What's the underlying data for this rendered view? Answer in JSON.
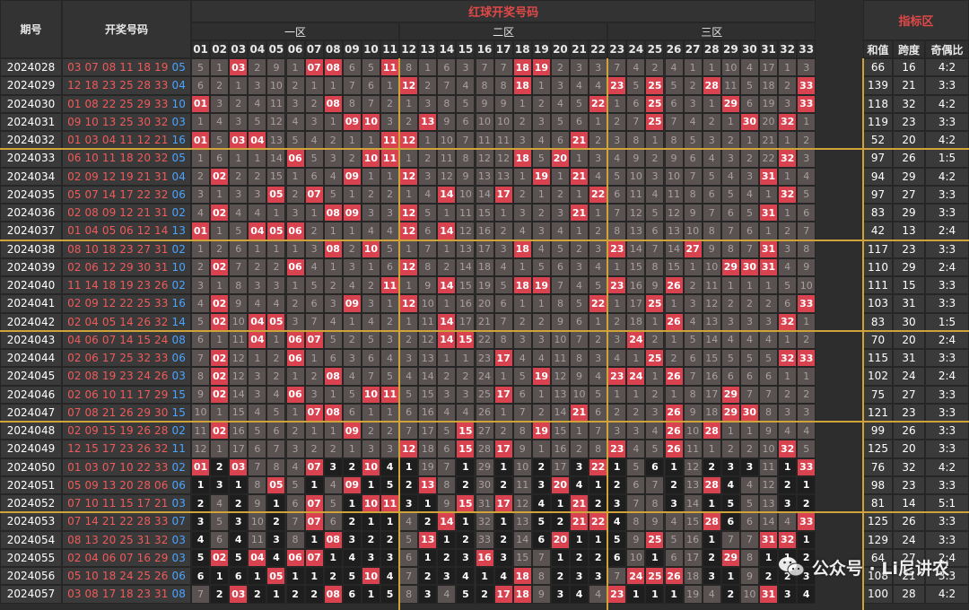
{
  "header": {
    "period_label": "期号",
    "numbers_label": "开奖号码",
    "red_title": "红球开奖号码",
    "index_title": "指标区",
    "zones": [
      "一区",
      "二区",
      "三区"
    ],
    "index_cols": [
      "和值",
      "跨度",
      "奇偶比"
    ]
  },
  "colors": {
    "hit": "#d9424f",
    "miss": "#5a5151",
    "dark": "#1e1e1e",
    "divider": "#cfa23a",
    "red_text": "#f05a5a",
    "blue_text": "#4aa3ff"
  },
  "rows": [
    {
      "p": "2024028",
      "red": "03 07 08 11 18 19",
      "blue": "05",
      "sum": "66",
      "span": "16",
      "ratio": "4:2",
      "miss": [
        5,
        1,
        0,
        2,
        9,
        1,
        0,
        0,
        6,
        5,
        0,
        8,
        1,
        6,
        3,
        7,
        7,
        0,
        0,
        2,
        3,
        3,
        7,
        4,
        2,
        4,
        1,
        1,
        10,
        4,
        17,
        1,
        3
      ]
    },
    {
      "p": "2024029",
      "red": "12 18 23 25 28 33",
      "blue": "04",
      "sum": "139",
      "span": "21",
      "ratio": "3:3",
      "miss": [
        6,
        2,
        1,
        3,
        10,
        2,
        1,
        1,
        7,
        6,
        1,
        0,
        2,
        7,
        4,
        8,
        8,
        0,
        1,
        3,
        4,
        4,
        0,
        5,
        0,
        5,
        2,
        0,
        11,
        5,
        18,
        2,
        0
      ]
    },
    {
      "p": "2024030",
      "red": "01 08 22 25 29 33",
      "blue": "10",
      "sum": "118",
      "span": "32",
      "ratio": "4:2",
      "miss": [
        0,
        3,
        2,
        4,
        11,
        3,
        2,
        0,
        8,
        7,
        2,
        1,
        3,
        8,
        5,
        9,
        9,
        1,
        2,
        4,
        5,
        0,
        1,
        6,
        0,
        6,
        3,
        1,
        0,
        6,
        19,
        3,
        0
      ]
    },
    {
      "p": "2024031",
      "red": "09 10 13 25 30 32",
      "blue": "03",
      "sum": "119",
      "span": "23",
      "ratio": "3:3",
      "miss": [
        1,
        4,
        3,
        5,
        12,
        4,
        3,
        1,
        0,
        0,
        3,
        2,
        0,
        9,
        6,
        10,
        10,
        2,
        3,
        5,
        6,
        1,
        2,
        7,
        0,
        7,
        4,
        2,
        1,
        0,
        20,
        0,
        1
      ]
    },
    {
      "p": "2024032",
      "red": "01 03 04 11 12 21",
      "blue": "16",
      "sum": "52",
      "span": "20",
      "ratio": "4:2",
      "miss": [
        0,
        5,
        0,
        0,
        13,
        5,
        4,
        2,
        1,
        1,
        0,
        0,
        1,
        10,
        7,
        11,
        11,
        3,
        4,
        6,
        0,
        2,
        3,
        8,
        1,
        8,
        5,
        3,
        2,
        1,
        21,
        1,
        2
      ]
    },
    {
      "p": "2024033",
      "red": "06 10 11 18 20 32",
      "blue": "05",
      "sum": "97",
      "span": "26",
      "ratio": "1:5",
      "miss": [
        1,
        6,
        1,
        1,
        14,
        0,
        5,
        3,
        2,
        0,
        0,
        1,
        2,
        11,
        8,
        12,
        12,
        0,
        5,
        0,
        1,
        3,
        4,
        9,
        2,
        9,
        6,
        4,
        3,
        2,
        22,
        0,
        3
      ]
    },
    {
      "p": "2024034",
      "red": "02 09 12 19 21 31",
      "blue": "04",
      "sum": "94",
      "span": "29",
      "ratio": "4:2",
      "miss": [
        2,
        0,
        2,
        2,
        15,
        1,
        6,
        4,
        0,
        1,
        1,
        0,
        3,
        12,
        9,
        13,
        13,
        1,
        0,
        1,
        0,
        4,
        5,
        10,
        3,
        10,
        7,
        5,
        4,
        3,
        0,
        1,
        4
      ]
    },
    {
      "p": "2024035",
      "red": "05 07 14 17 22 32",
      "blue": "06",
      "sum": "97",
      "span": "27",
      "ratio": "3:3",
      "miss": [
        3,
        1,
        3,
        3,
        0,
        2,
        0,
        5,
        1,
        2,
        2,
        1,
        4,
        0,
        10,
        14,
        0,
        2,
        1,
        2,
        1,
        0,
        6,
        11,
        4,
        11,
        8,
        6,
        5,
        4,
        1,
        0,
        5
      ]
    },
    {
      "p": "2024036",
      "red": "02 08 09 12 21 31",
      "blue": "02",
      "sum": "83",
      "span": "29",
      "ratio": "3:3",
      "miss": [
        4,
        0,
        4,
        4,
        1,
        3,
        1,
        0,
        0,
        3,
        3,
        0,
        5,
        1,
        11,
        15,
        1,
        3,
        2,
        3,
        0,
        1,
        7,
        12,
        5,
        12,
        9,
        7,
        6,
        5,
        0,
        1,
        6
      ]
    },
    {
      "p": "2024037",
      "red": "01 04 05 06 12 14",
      "blue": "13",
      "sum": "42",
      "span": "13",
      "ratio": "2:4",
      "miss": [
        0,
        1,
        5,
        0,
        0,
        0,
        2,
        1,
        1,
        4,
        4,
        0,
        6,
        0,
        12,
        16,
        2,
        4,
        3,
        4,
        1,
        2,
        8,
        13,
        6,
        13,
        10,
        8,
        7,
        6,
        1,
        2,
        7
      ]
    },
    {
      "p": "2024038",
      "red": "08 10 18 23 27 31",
      "blue": "02",
      "sum": "117",
      "span": "23",
      "ratio": "3:3",
      "miss": [
        1,
        2,
        6,
        1,
        1,
        1,
        3,
        0,
        2,
        0,
        5,
        1,
        7,
        1,
        13,
        17,
        3,
        0,
        4,
        5,
        2,
        3,
        0,
        14,
        7,
        14,
        0,
        9,
        8,
        7,
        0,
        3,
        8
      ]
    },
    {
      "p": "2024039",
      "red": "02 06 12 29 30 31",
      "blue": "10",
      "sum": "110",
      "span": "29",
      "ratio": "2:4",
      "miss": [
        2,
        0,
        7,
        2,
        2,
        0,
        4,
        1,
        3,
        1,
        6,
        0,
        8,
        2,
        14,
        18,
        4,
        1,
        5,
        6,
        3,
        4,
        1,
        15,
        8,
        15,
        1,
        10,
        0,
        0,
        0,
        4,
        9
      ]
    },
    {
      "p": "2024040",
      "red": "11 14 18 19 23 26",
      "blue": "02",
      "sum": "111",
      "span": "15",
      "ratio": "3:3",
      "miss": [
        3,
        1,
        8,
        3,
        3,
        1,
        5,
        2,
        4,
        2,
        0,
        1,
        9,
        0,
        15,
        19,
        5,
        0,
        0,
        7,
        4,
        5,
        0,
        16,
        9,
        0,
        2,
        11,
        1,
        1,
        1,
        5,
        10
      ]
    },
    {
      "p": "2024041",
      "red": "02 09 12 22 25 33",
      "blue": "16",
      "sum": "103",
      "span": "31",
      "ratio": "3:3",
      "miss": [
        4,
        0,
        9,
        4,
        4,
        2,
        6,
        3,
        0,
        3,
        1,
        0,
        10,
        1,
        16,
        20,
        6,
        1,
        1,
        8,
        5,
        0,
        1,
        17,
        0,
        1,
        3,
        12,
        2,
        2,
        2,
        6,
        0
      ]
    },
    {
      "p": "2024042",
      "red": "02 04 05 14 26 32",
      "blue": "14",
      "sum": "83",
      "span": "30",
      "ratio": "1:5",
      "miss": [
        5,
        0,
        10,
        0,
        0,
        3,
        7,
        4,
        1,
        4,
        2,
        1,
        11,
        0,
        17,
        21,
        7,
        2,
        2,
        9,
        6,
        1,
        2,
        18,
        1,
        0,
        4,
        13,
        3,
        3,
        3,
        0,
        1
      ]
    },
    {
      "p": "2024043",
      "red": "04 06 07 14 15 24",
      "blue": "08",
      "sum": "70",
      "span": "20",
      "ratio": "2:4",
      "miss": [
        6,
        1,
        11,
        0,
        1,
        0,
        0,
        5,
        2,
        5,
        3,
        2,
        12,
        0,
        0,
        22,
        8,
        3,
        3,
        10,
        7,
        2,
        3,
        0,
        2,
        1,
        5,
        14,
        4,
        4,
        4,
        1,
        2
      ]
    },
    {
      "p": "2024044",
      "red": "02 06 17 25 32 33",
      "blue": "06",
      "sum": "115",
      "span": "31",
      "ratio": "3:3",
      "miss": [
        7,
        0,
        12,
        1,
        2,
        0,
        1,
        6,
        3,
        6,
        4,
        3,
        13,
        1,
        1,
        23,
        0,
        4,
        4,
        11,
        8,
        3,
        4,
        1,
        0,
        2,
        6,
        15,
        5,
        5,
        5,
        0,
        0
      ]
    },
    {
      "p": "2024045",
      "red": "02 08 19 23 24 26",
      "blue": "03",
      "sum": "102",
      "span": "24",
      "ratio": "2:4",
      "miss": [
        8,
        0,
        12,
        3,
        2,
        1,
        2,
        0,
        4,
        7,
        5,
        4,
        14,
        2,
        2,
        24,
        1,
        5,
        0,
        12,
        9,
        4,
        0,
        0,
        1,
        0,
        7,
        16,
        6,
        6,
        6,
        1,
        1
      ]
    },
    {
      "p": "2024046",
      "red": "02 06 10 11 17 29",
      "blue": "15",
      "sum": "75",
      "span": "27",
      "ratio": "3:3",
      "miss": [
        9,
        0,
        14,
        3,
        4,
        0,
        3,
        1,
        5,
        0,
        0,
        5,
        15,
        3,
        3,
        25,
        0,
        6,
        1,
        13,
        10,
        5,
        1,
        1,
        2,
        1,
        8,
        17,
        0,
        7,
        7,
        2,
        2
      ]
    },
    {
      "p": "2024047",
      "red": "07 08 21 26 29 30",
      "blue": "15",
      "sum": "121",
      "span": "23",
      "ratio": "3:3",
      "miss": [
        10,
        1,
        15,
        4,
        5,
        1,
        0,
        0,
        6,
        1,
        1,
        6,
        16,
        4,
        4,
        26,
        1,
        7,
        2,
        14,
        0,
        6,
        2,
        2,
        3,
        0,
        9,
        18,
        0,
        0,
        8,
        3,
        3
      ]
    },
    {
      "p": "2024048",
      "red": "02 09 15 19 26 28",
      "blue": "02",
      "sum": "99",
      "span": "26",
      "ratio": "3:3",
      "miss": [
        11,
        0,
        16,
        5,
        6,
        2,
        1,
        1,
        0,
        2,
        2,
        7,
        17,
        5,
        0,
        27,
        2,
        8,
        0,
        15,
        1,
        7,
        3,
        3,
        4,
        0,
        10,
        0,
        1,
        1,
        9,
        4,
        4
      ]
    },
    {
      "p": "2024049",
      "red": "12 15 17 23 26 32",
      "blue": "11",
      "sum": "125",
      "span": "20",
      "ratio": "3:3",
      "miss": [
        12,
        1,
        17,
        6,
        7,
        3,
        2,
        2,
        1,
        3,
        3,
        0,
        18,
        6,
        0,
        28,
        0,
        9,
        1,
        16,
        2,
        8,
        0,
        4,
        5,
        0,
        11,
        1,
        2,
        2,
        10,
        0,
        5
      ]
    },
    {
      "p": "2024050",
      "red": "01 03 07 10 22 33",
      "blue": "02",
      "sum": "76",
      "span": "32",
      "ratio": "4:2",
      "miss": [
        0,
        2,
        0,
        7,
        8,
        4,
        0,
        3,
        2,
        0,
        4,
        1,
        19,
        7,
        1,
        29,
        1,
        10,
        2,
        17,
        3,
        0,
        1,
        5,
        6,
        1,
        12,
        2,
        3,
        3,
        11,
        1,
        0
      ]
    },
    {
      "p": "2024051",
      "red": "05 09 13 20 28 06",
      "blue": "06",
      "sum": "98",
      "span": "23",
      "ratio": "3:3",
      "miss": [
        1,
        3,
        1,
        8,
        0,
        5,
        1,
        4,
        0,
        1,
        5,
        2,
        0,
        8,
        2,
        30,
        2,
        11,
        3,
        0,
        4,
        1,
        2,
        6,
        7,
        2,
        13,
        0,
        4,
        4,
        12,
        2,
        1
      ]
    },
    {
      "p": "2024052",
      "red": "07 10 11 15 17 21",
      "blue": "03",
      "sum": "81",
      "span": "14",
      "ratio": "5:1",
      "miss": [
        2,
        4,
        2,
        9,
        1,
        6,
        0,
        5,
        1,
        0,
        0,
        3,
        1,
        9,
        0,
        31,
        0,
        12,
        4,
        1,
        0,
        2,
        3,
        7,
        8,
        3,
        14,
        1,
        5,
        5,
        13,
        3,
        2
      ]
    },
    {
      "p": "2024053",
      "red": "07 14 21 22 28 33",
      "blue": "07",
      "sum": "125",
      "span": "26",
      "ratio": "3:3",
      "miss": [
        3,
        5,
        3,
        10,
        2,
        7,
        0,
        6,
        2,
        1,
        1,
        4,
        2,
        0,
        1,
        32,
        1,
        13,
        5,
        2,
        0,
        0,
        4,
        8,
        9,
        4,
        15,
        0,
        6,
        6,
        14,
        4,
        0
      ]
    },
    {
      "p": "2024054",
      "red": "08 13 20 25 31 32",
      "blue": "03",
      "sum": "129",
      "span": "24",
      "ratio": "3:3",
      "miss": [
        4,
        6,
        4,
        11,
        3,
        8,
        1,
        0,
        3,
        2,
        2,
        5,
        0,
        1,
        2,
        33,
        2,
        14,
        6,
        0,
        1,
        1,
        5,
        9,
        0,
        5,
        16,
        1,
        7,
        7,
        0,
        0,
        1
      ]
    },
    {
      "p": "2024055",
      "red": "02 04 06 07 16 29",
      "blue": "03",
      "sum": "64",
      "span": "27",
      "ratio": "2:4",
      "miss": [
        5,
        0,
        5,
        0,
        4,
        0,
        0,
        1,
        4,
        3,
        3,
        6,
        1,
        2,
        3,
        0,
        3,
        15,
        7,
        1,
        2,
        2,
        6,
        10,
        1,
        6,
        17,
        2,
        0,
        8,
        1,
        1,
        2
      ]
    },
    {
      "p": "2024056",
      "red": "05 10 18 24 25 26",
      "blue": "06",
      "sum": "108",
      "span": "21",
      "ratio": "3:3",
      "miss": [
        6,
        1,
        6,
        1,
        0,
        1,
        1,
        2,
        5,
        0,
        4,
        7,
        2,
        3,
        4,
        1,
        4,
        0,
        8,
        2,
        3,
        3,
        7,
        0,
        0,
        0,
        18,
        3,
        1,
        9,
        2,
        2,
        3
      ]
    },
    {
      "p": "2024057",
      "red": "03 08 17 18 23 31",
      "blue": "08",
      "sum": "100",
      "span": "28",
      "ratio": "4:2",
      "miss": [
        7,
        2,
        0,
        2,
        1,
        2,
        2,
        0,
        6,
        1,
        5,
        8,
        3,
        4,
        5,
        2,
        0,
        0,
        9,
        3,
        4,
        4,
        0,
        1,
        1,
        1,
        19,
        4,
        2,
        10,
        0,
        3,
        4
      ]
    }
  ],
  "watermark": {
    "icon": "wechat-icon",
    "text": "公众号 · Li尼讲农"
  }
}
